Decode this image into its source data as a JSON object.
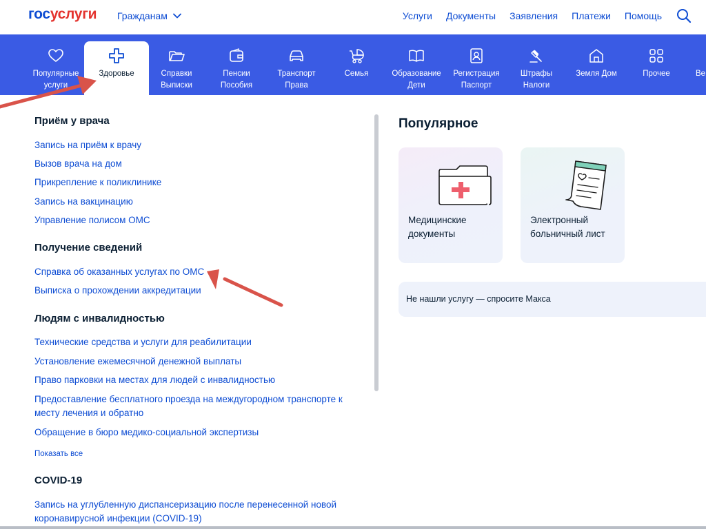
{
  "header": {
    "logo_part1": "гос",
    "logo_part2": "услуги",
    "role": "Гражданам",
    "nav": [
      "Услуги",
      "Документы",
      "Заявления",
      "Платежи",
      "Помощь"
    ]
  },
  "categories": [
    {
      "line1": "Популярные",
      "line2": "услуги",
      "icon": "heart-icon"
    },
    {
      "line1": "Здоровье",
      "line2": "",
      "icon": "medical-cross-icon"
    },
    {
      "line1": "Справки",
      "line2": "Выписки",
      "icon": "folder-icon"
    },
    {
      "line1": "Пенсии",
      "line2": "Пособия",
      "icon": "wallet-icon"
    },
    {
      "line1": "Транспорт",
      "line2": "Права",
      "icon": "car-icon"
    },
    {
      "line1": "Семья",
      "line2": "",
      "icon": "stroller-icon"
    },
    {
      "line1": "Образование",
      "line2": "Дети",
      "icon": "book-icon"
    },
    {
      "line1": "Регистрация",
      "line2": "Паспорт",
      "icon": "passport-icon"
    },
    {
      "line1": "Штрафы",
      "line2": "Налоги",
      "icon": "gavel-icon"
    },
    {
      "line1": "Земля Дом",
      "line2": "",
      "icon": "house-icon"
    },
    {
      "line1": "Прочее",
      "line2": "",
      "icon": "grid-icon"
    },
    {
      "line1": "Ве",
      "line2": "",
      "icon": ""
    }
  ],
  "sections": {
    "doctor": {
      "title": "Приём у врача",
      "links": [
        "Запись на приём к врачу",
        "Вызов врача на дом",
        "Прикрепление к поликлинике",
        "Запись на вакцинацию",
        "Управление полисом ОМС"
      ]
    },
    "info": {
      "title": "Получение сведений",
      "links": [
        "Справка об оказанных услугах по ОМС",
        "Выписка о прохождении аккредитации"
      ]
    },
    "disability": {
      "title": "Людям с инвалидностью",
      "links": [
        "Технические средства и услуги для реабилитации",
        "Установление ежемесячной денежной выплаты",
        "Право парковки на местах для людей с инвалидностью",
        "Предоставление бесплатного проезда на междугородном транспорте к",
        "месту лечения и обратно",
        "Обращение в бюро медико-социальной экспертизы"
      ],
      "show_all": "Показать все"
    },
    "covid": {
      "title": "COVID-19",
      "links": [
        "Запись на углубленную диспансеризацию после перенесенной новой",
        "коронавирусной инфекции (COVID-19)"
      ]
    }
  },
  "popular": {
    "title": "Популярное",
    "cards": [
      {
        "line1": "Медицинские",
        "line2": "документы",
        "icon": "medical-folder-icon"
      },
      {
        "line1": "Электронный",
        "line2": "больничный лист",
        "icon": "sick-leave-document-icon"
      }
    ],
    "ask": "Не нашли услугу — спросите Макса"
  },
  "colors": {
    "brand_blue": "#0d4cd3",
    "brand_red": "#e4332e",
    "nav_bar": "#3a5be4",
    "annotation_arrow": "#d9534a"
  }
}
